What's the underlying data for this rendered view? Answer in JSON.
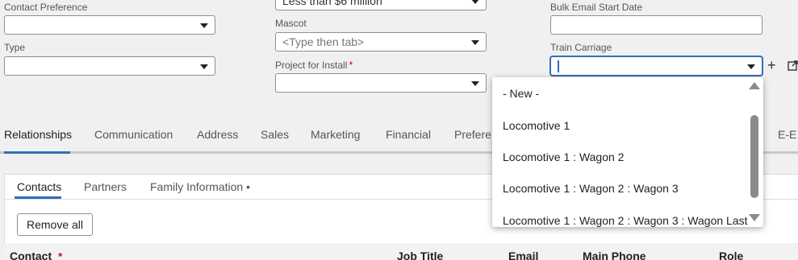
{
  "form": {
    "contact_preference": {
      "label": "Contact Preference",
      "value": ""
    },
    "top_middle": {
      "value": "Less than $6 million"
    },
    "mascot": {
      "label": "Mascot",
      "placeholder": "<Type then tab>"
    },
    "type": {
      "label": "Type",
      "value": ""
    },
    "project_for_install": {
      "label": "Project for Install",
      "required_mark": "*",
      "value": ""
    },
    "bulk_email_start_date": {
      "label": "Bulk Email Start Date",
      "value": ""
    },
    "train_carriage": {
      "label": "Train Carriage",
      "value": ""
    }
  },
  "train_carriage_dropdown": {
    "options": [
      "- New -",
      "Locomotive 1",
      "Locomotive 1 : Wagon 2",
      "Locomotive 1 : Wagon 2 : Wagon 3",
      "Locomotive 1 : Wagon 2 : Wagon 3 : Wagon Last"
    ]
  },
  "tabs": [
    {
      "label": "Relationships",
      "active": true
    },
    {
      "label": "Communication"
    },
    {
      "label": "Address"
    },
    {
      "label": "Sales"
    },
    {
      "label": "Marketing"
    },
    {
      "label": "Financial"
    },
    {
      "label": "Prefere"
    },
    {
      "label": "E-E"
    }
  ],
  "subtabs": [
    {
      "label": "Contacts",
      "active": true
    },
    {
      "label": "Partners"
    },
    {
      "label": "Family Information •"
    }
  ],
  "actions": {
    "remove_all": "Remove all"
  },
  "table": {
    "columns": [
      {
        "label": "Contact",
        "required_mark": "*"
      },
      {
        "label": "Job Title"
      },
      {
        "label": "Email"
      },
      {
        "label": "Main Phone"
      },
      {
        "label": "Role"
      }
    ]
  },
  "colors": {
    "accent": "#2f6fbd",
    "required": "#d0021b"
  }
}
